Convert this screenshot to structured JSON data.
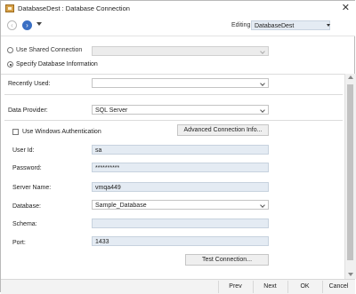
{
  "window": {
    "title": "DatabaseDest : Database Connection"
  },
  "toolbar": {
    "editing_label": "Editing:",
    "editing_value": "DatabaseDest"
  },
  "connection": {
    "use_shared_label": "Use Shared Connection",
    "specify_label": "Specify Database Information",
    "selected": "specify"
  },
  "form": {
    "recently_used_label": "Recently Used:",
    "recently_used_value": "",
    "data_provider_label": "Data Provider:",
    "data_provider_value": "SQL Server",
    "windows_auth_label": "Use Windows Authentication",
    "windows_auth_checked": false,
    "advanced_button": "Advanced Connection Info...",
    "user_id_label": "User Id:",
    "user_id_value": "sa",
    "password_label": "Password:",
    "password_value": "**********",
    "server_name_label": "Server Name:",
    "server_name_value": "vmqa449",
    "database_label": "Database:",
    "database_value": "Sample_Database",
    "schema_label": "Schema:",
    "schema_value": "",
    "port_label": "Port:",
    "port_value": "1433",
    "test_button": "Test Connection..."
  },
  "footer": {
    "prev": "Prev",
    "next": "Next",
    "ok": "OK",
    "cancel": "Cancel"
  },
  "icons": {
    "title": "database-connection-icon",
    "back": "back-arrow-icon",
    "forward": "forward-arrow-icon",
    "close": "close-icon"
  }
}
